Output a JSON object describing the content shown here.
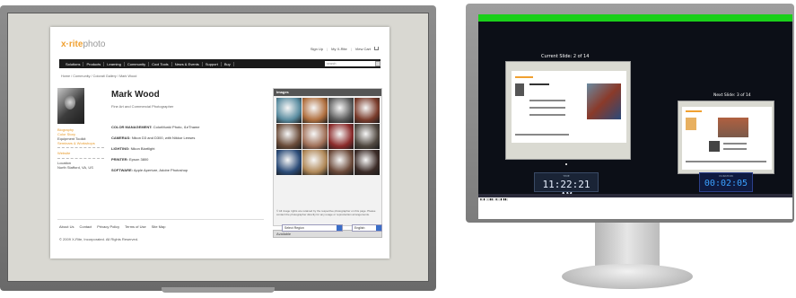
{
  "left_page": {
    "brand": {
      "name": "xritephoto",
      "prefix": "x·rite",
      "suffix": "photo"
    },
    "toplinks": [
      "Sign Up",
      "My X-Rite",
      "View Cart"
    ],
    "nav": [
      "Solutions",
      "Products",
      "Learning",
      "Community",
      "Cool Tools",
      "News & Events",
      "Support",
      "Buy"
    ],
    "search_placeholder": "search",
    "breadcrumb": "Home / Community / Colorati Gallery / Mark Wood",
    "profile": {
      "name": "Mark Wood",
      "subtitle": "Fine Art and Commercial Photographer",
      "details": [
        {
          "k": "COLOR MANAGEMENT:",
          "v": "ColorMunki Photo, i1eThame"
        },
        {
          "k": "CAMERAS:",
          "v": "Nikon D3 and D300, with Nikkor Lenses"
        },
        {
          "k": "LIGHTING:",
          "v": "Nikon Blartlight"
        },
        {
          "k": "PRINTER:",
          "v": "Epson 3800"
        },
        {
          "k": "SOFTWARE:",
          "v": "Apple Aperture, Adobe Photoshop"
        }
      ]
    },
    "sidebar": {
      "orange_links": [
        "Biography",
        "Color Story",
        "Seminars & Workshops"
      ],
      "gray_links": [
        "Equipment Toolkit"
      ],
      "website": "Website",
      "location_label": "Location",
      "location_value": "North Stafford, VA, US"
    },
    "images_panel": {
      "title": "Images",
      "rights": "© All image rights are retained by the respective photographer on this page. Please contact the photographer directly for any usage or reproduction arrangements.",
      "available": "Available"
    },
    "thumb_colors": [
      "#5a8ca0",
      "#b07040",
      "#5c5c5c",
      "#7a3c2c",
      "#6a4c3a",
      "#a07058",
      "#8c2c2c",
      "#504840",
      "#2c4c78",
      "#b08858",
      "#6c4a3a",
      "#3c2c28"
    ],
    "footer": {
      "links": [
        "About Us",
        "Contact",
        "Privacy Policy",
        "Terms of Use",
        "Site Map"
      ],
      "copyright": "© 2009 X-Rite, Incorporated. All Rights Reserved.",
      "region_select": "Select Region",
      "language_select": "English"
    }
  },
  "monitor": {
    "current_slide_label": "Current Slide: 2 of 14",
    "next_slide_label": "Next Slide: 3 of 14",
    "clock_label": "TIME",
    "clock_value": "11:22:21 AM",
    "timer_label": "DURATION",
    "timer_value": "00:02:05",
    "status_colors": {
      "top_bar": "#1ad01a",
      "clock_bg": "#1a2436",
      "timer_text": "#3aa0ff"
    }
  }
}
